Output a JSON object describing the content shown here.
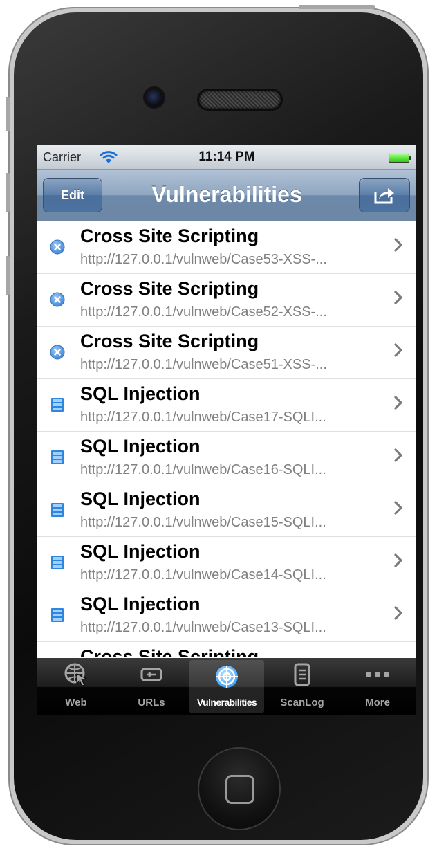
{
  "status_bar": {
    "carrier": "Carrier",
    "time": "11:14 PM"
  },
  "nav": {
    "title": "Vulnerabilities",
    "edit_label": "Edit",
    "share_icon": "share-icon"
  },
  "colors": {
    "xss_icon": "#5a9be0",
    "sql_icon": "#3a8fe0",
    "nav_top": "#b1c2d6",
    "nav_bottom": "#6d87a5"
  },
  "vulnerabilities": [
    {
      "title": "Cross Site Scripting",
      "url": "http://127.0.0.1/vulnweb/Case53-XSS-...",
      "icon": "xss-icon"
    },
    {
      "title": "Cross Site Scripting",
      "url": "http://127.0.0.1/vulnweb/Case52-XSS-...",
      "icon": "xss-icon"
    },
    {
      "title": "Cross Site Scripting",
      "url": "http://127.0.0.1/vulnweb/Case51-XSS-...",
      "icon": "xss-icon"
    },
    {
      "title": "SQL Injection",
      "url": "http://127.0.0.1/vulnweb/Case17-SQLI...",
      "icon": "database-icon"
    },
    {
      "title": "SQL Injection",
      "url": "http://127.0.0.1/vulnweb/Case16-SQLI...",
      "icon": "database-icon"
    },
    {
      "title": "SQL Injection",
      "url": "http://127.0.0.1/vulnweb/Case15-SQLI...",
      "icon": "database-icon"
    },
    {
      "title": "SQL Injection",
      "url": "http://127.0.0.1/vulnweb/Case14-SQLI...",
      "icon": "database-icon"
    },
    {
      "title": "SQL Injection",
      "url": "http://127.0.0.1/vulnweb/Case13-SQLI...",
      "icon": "database-icon"
    },
    {
      "title": "Cross Site Scripting",
      "url": "",
      "icon": "xss-icon"
    }
  ],
  "tabs": [
    {
      "label": "Web",
      "icon": "globe-cursor-icon"
    },
    {
      "label": "URLs",
      "icon": "link-icon"
    },
    {
      "label": "Vulnerabilities",
      "icon": "target-icon",
      "selected": true
    },
    {
      "label": "ScanLog",
      "icon": "log-icon"
    },
    {
      "label": "More",
      "icon": "more-icon"
    }
  ]
}
